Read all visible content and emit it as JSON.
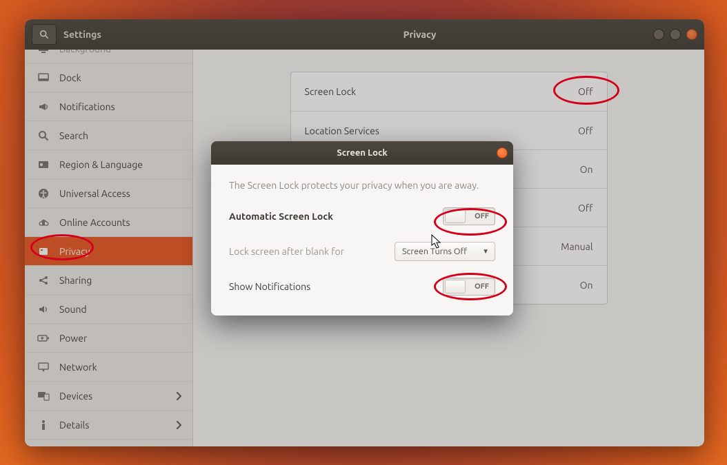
{
  "window": {
    "app_title": "Settings",
    "page_title": "Privacy"
  },
  "sidebar": {
    "items": [
      {
        "label": "Background",
        "icon": "desktop-icon",
        "dim": true
      },
      {
        "label": "Dock",
        "icon": "dock-icon"
      },
      {
        "label": "Notifications",
        "icon": "megaphone-icon"
      },
      {
        "label": "Search",
        "icon": "search-icon"
      },
      {
        "label": "Region & Language",
        "icon": "globe-icon"
      },
      {
        "label": "Universal Access",
        "icon": "accessibility-icon"
      },
      {
        "label": "Online Accounts",
        "icon": "cloud-icon"
      },
      {
        "label": "Privacy",
        "icon": "privacy-icon",
        "selected": true
      },
      {
        "label": "Sharing",
        "icon": "share-icon"
      },
      {
        "label": "Sound",
        "icon": "speaker-icon"
      },
      {
        "label": "Power",
        "icon": "battery-icon"
      },
      {
        "label": "Network",
        "icon": "network-icon"
      },
      {
        "label": "Devices",
        "icon": "devices-icon",
        "chevron": true
      },
      {
        "label": "Details",
        "icon": "details-icon",
        "chevron": true
      }
    ]
  },
  "privacy_rows": [
    {
      "label": "Screen Lock",
      "value": "Off"
    },
    {
      "label": "Location Services",
      "value": "Off"
    },
    {
      "label": "",
      "value": "On"
    },
    {
      "label": "",
      "value": "Off"
    },
    {
      "label": "",
      "value": "Manual"
    },
    {
      "label": "",
      "value": "On"
    }
  ],
  "dialog": {
    "title": "Screen Lock",
    "description": "The Screen Lock protects your privacy when you are away.",
    "auto_lock_label": "Automatic Screen Lock",
    "auto_lock_value": "OFF",
    "blank_label": "Lock screen after blank for",
    "blank_value": "Screen Turns Off",
    "notif_label": "Show Notifications",
    "notif_value": "OFF"
  }
}
